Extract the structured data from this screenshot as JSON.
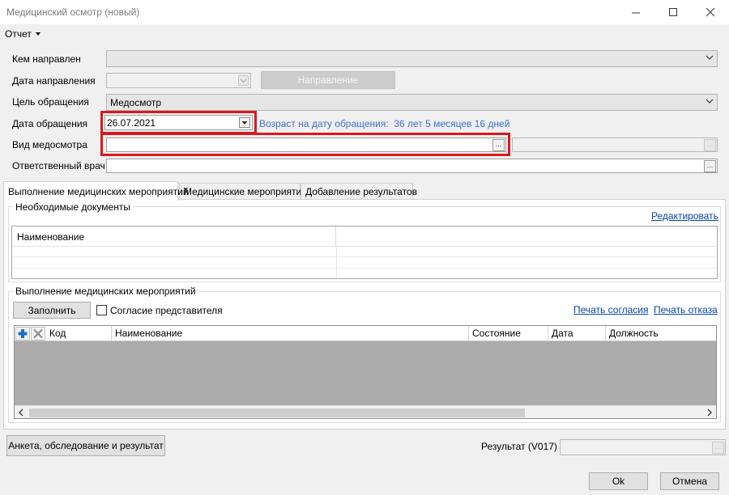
{
  "window": {
    "title": "Медицинский осмотр (новый)"
  },
  "menu": {
    "report_label": "Отчет"
  },
  "form": {
    "referred_by_label": "Кем направлен",
    "referred_by_value": "",
    "referral_date_label": "Дата направления",
    "referral_date_value": "",
    "referral_button_label": "Направление",
    "purpose_label": "Цель обращения",
    "purpose_value": "Медосмотр",
    "visit_date_label": "Дата обращения",
    "visit_date_value": "26.07.2021",
    "age_on_visit_text": "Возраст на дату обращения:  36 лет 5 месяцев 16 дней",
    "exam_type_label": "Вид медосмотра",
    "exam_type_value": "",
    "responsible_doctor_label": "Ответственный врач",
    "responsible_doctor_value": ""
  },
  "tabs": [
    {
      "label": "Выполнение медицинских мероприятий",
      "active": true
    },
    {
      "label": "Медицинские мероприятия",
      "active": false
    },
    {
      "label": "Добавление результатов",
      "active": false
    }
  ],
  "documents_group": {
    "title": "Необходимые документы",
    "edit_link": "Редактировать",
    "columns": [
      "Наименование"
    ]
  },
  "activities_group": {
    "title": "Выполнение медицинских мероприятий",
    "fill_button": "Заполнить",
    "consent_checkbox_label": "Согласие представителя",
    "consent_checked": false,
    "print_consent_link": "Печать согласия",
    "print_refusal_link": "Печать отказа",
    "columns": [
      "Код",
      "Наименование",
      "Состояние",
      "Дата",
      "Должность"
    ]
  },
  "footer": {
    "survey_button": "Анкета, обследование и результат",
    "result_label": "Результат (V017)",
    "result_value": "",
    "ok_button": "Ok",
    "cancel_button": "Отмена"
  },
  "colors": {
    "highlight": "#d71920",
    "link": "#0645ad",
    "info_text": "#3f6fd1",
    "grid_empty": "#ababab"
  }
}
